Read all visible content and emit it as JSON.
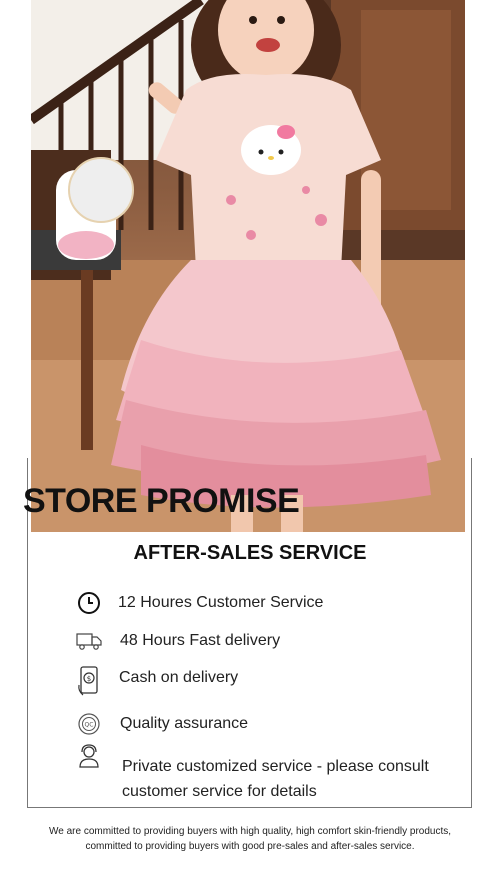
{
  "promise": {
    "title": "STORE PROMISE"
  },
  "service": {
    "title": "AFTER-SALES SERVICE",
    "items": [
      {
        "icon": "clock-icon",
        "label": "12 Houres Customer Service"
      },
      {
        "icon": "delivery-truck-icon",
        "label": "48 Hours Fast delivery"
      },
      {
        "icon": "cash-phone-icon",
        "label": "Cash on delivery"
      },
      {
        "icon": "quality-badge-icon",
        "label": "Quality assurance"
      },
      {
        "icon": "customer-service-agent-icon",
        "label": "Private customized service - please consult customer service for details"
      }
    ]
  },
  "footer": {
    "line1": "We are committed to providing buyers with high quality, high comfort skin-friendly products,",
    "line2": "committed to providing buyers with good pre-sales and after-sales service."
  }
}
